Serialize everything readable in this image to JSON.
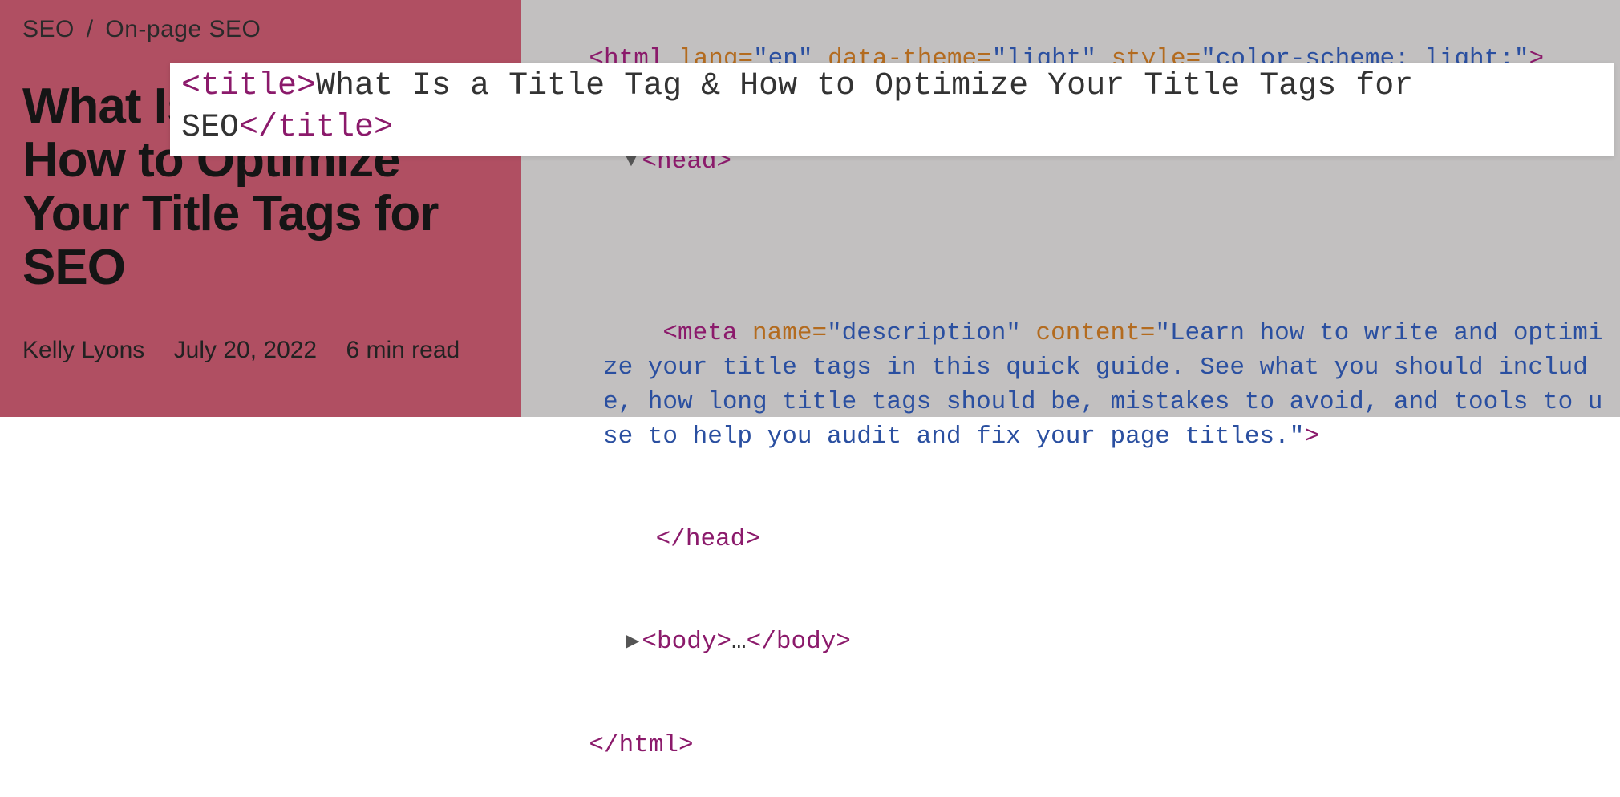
{
  "breadcrumb": {
    "item1": "SEO",
    "separator": "/",
    "item2": "On-page SEO"
  },
  "article": {
    "title": "What Is a Title Tag & How to Optimize Your Title Tags for SEO",
    "author": "Kelly Lyons",
    "date": "July 20, 2022",
    "read_time": "6 min read"
  },
  "code": {
    "html_open": "<html",
    "lang_attr": " lang=",
    "lang_val": "\"en\"",
    "theme_attr": " data-theme=",
    "theme_val": "\"light\"",
    "style_attr": " style=",
    "style_val": "\"color-scheme: light;\"",
    "close_angle": ">",
    "head_open": "<head>",
    "meta_open": "<meta",
    "meta_name_attr": " name=",
    "meta_name_val": "\"description\"",
    "meta_content_attr": " content=",
    "meta_content_val": "\"Learn how to write and optimize your title tags in this quick guide. See what you should include, how long title tags should be, mistakes to avoid, and tools to use to help you audit and fix your page titles.\"",
    "head_close": "</head>",
    "body_open": "<body>",
    "body_ellipsis": "…",
    "body_close": "</body>",
    "html_close": "</html>"
  },
  "highlight": {
    "title_open": "<title>",
    "title_text": "What Is a Title Tag & How to Optimize Your Title Tags for SEO",
    "title_close": "</title>"
  },
  "glyphs": {
    "triangle_down": "▼",
    "triangle_right": "▶"
  }
}
